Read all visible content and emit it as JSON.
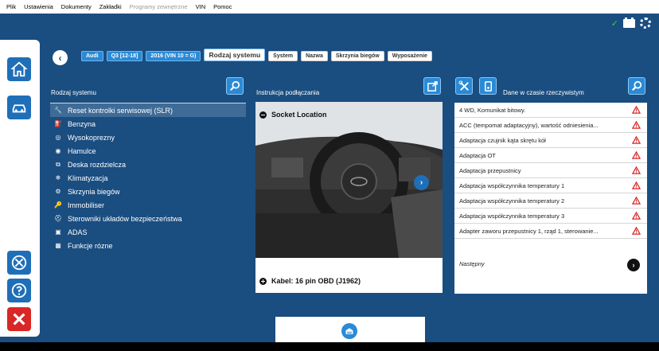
{
  "menubar": {
    "items": [
      "Plik",
      "Ustawienia",
      "Dokumenty",
      "Zakładki"
    ],
    "disabled_item": "Programy zewnętrzne",
    "items_after": [
      "VIN",
      "Pomoc"
    ]
  },
  "status": {
    "check": "✓"
  },
  "breadcrumb": {
    "items": [
      "Audi",
      "Q3 [12-18]",
      "2016 (VIN 10 = G)"
    ],
    "active": "Rodzaj systemu",
    "more": [
      "System",
      "Nazwa",
      "Skrzynia biegów",
      "Wyposażenie"
    ]
  },
  "left_panel": {
    "title": "Rodzaj systemu",
    "items": [
      {
        "label": "Reset kontrolki serwisowej (SLR)",
        "icon": "wrench-icon",
        "glyph": "🔧"
      },
      {
        "label": "Benzyna",
        "icon": "fuel-icon",
        "glyph": "⛽"
      },
      {
        "label": "Wysokoprezny",
        "icon": "diesel-icon",
        "glyph": "◎"
      },
      {
        "label": "Hamulce",
        "icon": "brake-icon",
        "glyph": "◉"
      },
      {
        "label": "Deska rozdzielcza",
        "icon": "dashboard-icon",
        "glyph": "⧉"
      },
      {
        "label": "Klimatyzacja",
        "icon": "aircon-icon",
        "glyph": "❄"
      },
      {
        "label": "Skrzynia biegów",
        "icon": "gearbox-icon",
        "glyph": "⚙"
      },
      {
        "label": "Immobiliser",
        "icon": "key-icon",
        "glyph": "🔑"
      },
      {
        "label": "Sterowniki układów bezpieczeństwa",
        "icon": "airbag-icon",
        "glyph": "⛑"
      },
      {
        "label": "ADAS",
        "icon": "adas-icon",
        "glyph": "▣"
      },
      {
        "label": "Funkcje rózne",
        "icon": "misc-icon",
        "glyph": "▦"
      }
    ]
  },
  "mid_panel": {
    "title": "Instrukcja podłączania",
    "socket_label": "Socket Location",
    "cable_label": "Kabel: 16 pin OBD (J1962)",
    "next": "›"
  },
  "right_panel": {
    "title": "Dane w czasie rzeczywistym",
    "items": [
      "4 WD, Komunikat bitowy.",
      "ACC (tempomat adaptacyjny), wartość odniesienia...",
      "Adaptacja czujnik kąta skrętu kół",
      "Adaptacja OT",
      "Adaptacja przepustnicy",
      "Adaptacja współczynnika temperatury 1",
      "Adaptacja współczynnika temperatury 2",
      "Adaptacja współczynnika temperatury 3",
      "Adapter zaworu przepustnicy 1, rząd 1, sterowanie..."
    ],
    "next_label": "Następny",
    "next_btn": "›"
  },
  "colors": {
    "bg": "#1a4d80",
    "accent": "#2a8ad6",
    "warn": "#d92626"
  }
}
